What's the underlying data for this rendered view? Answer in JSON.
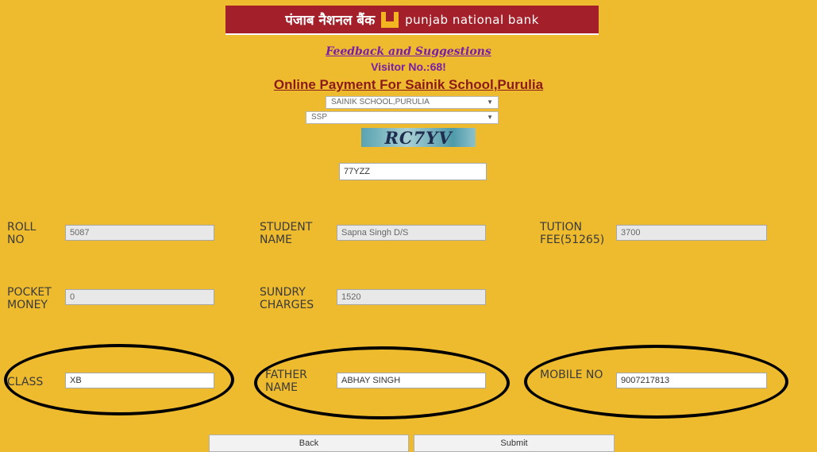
{
  "header": {
    "hindi_name": "पंजाब नैशनल बैंक",
    "english_name": "punjab national bank",
    "logo_icon": "pnb-logo-icon"
  },
  "feedback_link": "Feedback and Suggestions",
  "visitor": "Visitor No.:68!",
  "page_title": "Online Payment For Sainik School,Purulia",
  "school_select": {
    "value": "SAINIK SCHOOL,PURULIA"
  },
  "category_select": {
    "value": "SSP"
  },
  "captcha": {
    "image_text": "RC7YV",
    "input_value": "77YZZ"
  },
  "fields": {
    "roll_no": {
      "label": "ROLL NO",
      "value": "5087"
    },
    "student_name": {
      "label": "STUDENT NAME",
      "value": "Sapna Singh D/S"
    },
    "tution_fee": {
      "label": "TUTION FEE(51265)",
      "value": "3700"
    },
    "pocket_money": {
      "label": "POCKET MONEY",
      "value": "0"
    },
    "sundry_charges": {
      "label": "SUNDRY CHARGES",
      "value": "1520"
    },
    "class": {
      "label": "CLASS",
      "value": "XB"
    },
    "father_name": {
      "label": "FATHER NAME",
      "value": "ABHAY SINGH"
    },
    "mobile_no": {
      "label": "MOBILE NO",
      "value": "9007217813"
    }
  },
  "buttons": {
    "back": "Back",
    "submit": "Submit"
  },
  "colors": {
    "background": "#efbb2e",
    "banner": "#a3202a",
    "title": "#8b1a1a",
    "link": "#7a1da8"
  }
}
